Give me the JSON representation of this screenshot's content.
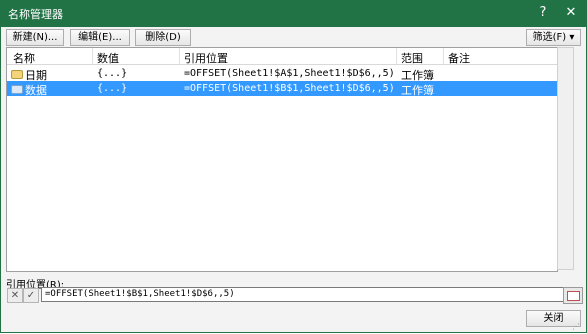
{
  "window": {
    "title": "名称管理器",
    "help_label": "?",
    "close_label": "✕"
  },
  "toolbar": {
    "new_label": "新建(N)...",
    "edit_label": "编辑(E)...",
    "delete_label": "删除(D)",
    "filter_label": "筛选(F) ▾"
  },
  "list": {
    "columns": [
      "名称",
      "数值",
      "引用位置",
      "范围",
      "备注"
    ],
    "rows": [
      {
        "name": "日期",
        "value": "{...}",
        "ref": "=OFFSET(Sheet1!$A$1,Sheet1!$D$6,,5)",
        "scope": "工作簿",
        "note": "",
        "selected": false
      },
      {
        "name": "数据",
        "value": "{...}",
        "ref": "=OFFSET(Sheet1!$B$1,Sheet1!$D$6,,5)",
        "scope": "工作簿",
        "note": "",
        "selected": true
      }
    ]
  },
  "refers_to": {
    "label": "引用位置(R):",
    "value": "=OFFSET(Sheet1!$B$1,Sheet1!$D$6,,5)",
    "cancel_symbol": "✕",
    "confirm_symbol": "✓"
  },
  "footer": {
    "close_label": "关闭"
  },
  "colors": {
    "titlebar": "#217346",
    "selection": "#3399ff"
  }
}
